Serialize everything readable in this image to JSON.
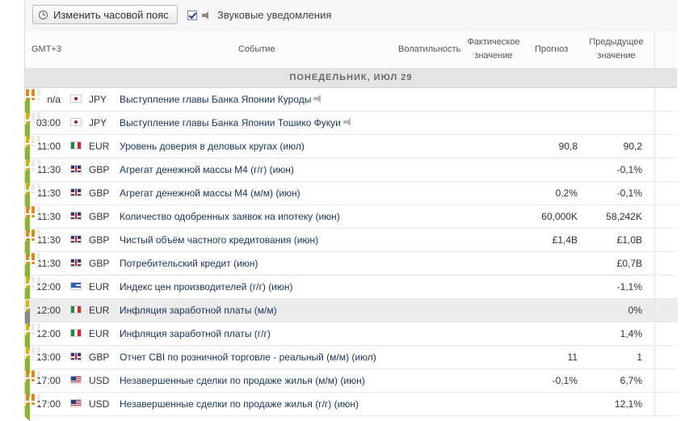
{
  "toolbar": {
    "timezone_button": "Изменить часовой пояс",
    "sound_label": "Звуковые уведомления",
    "sound_checked": true
  },
  "columns": {
    "gmt": "GMT+3",
    "event": "Событие",
    "volatility": "Волатильность",
    "actual": "Фактическое значение",
    "forecast": "Прогноз",
    "previous": "Предыдущее значение"
  },
  "day_header": "ПОНЕДЕЛЬНИК, ИЮЛ 29",
  "colors": {
    "yellow_bang": "#d8b200",
    "orange_bang": "#d98a17",
    "event_text": "#1b3760",
    "arrow": "#88b72f"
  },
  "rows": [
    {
      "time": "n/a",
      "flag": "jp",
      "currency": "JPY",
      "event": "Выступление главы Банка Японии Куроды",
      "speech": true,
      "volatility": 2,
      "actual": "",
      "forecast": "",
      "previous": "",
      "highlight": false
    },
    {
      "time": "03:00",
      "flag": "jp",
      "currency": "JPY",
      "event": "Выступление главы Банка Японии Тошико Фукуи",
      "speech": true,
      "volatility": 1,
      "actual": "",
      "forecast": "",
      "previous": "",
      "highlight": false
    },
    {
      "time": "11:00",
      "flag": "it",
      "currency": "EUR",
      "event": "Уровень доверия в деловых кругах (июл)",
      "speech": false,
      "volatility": 1,
      "actual": "",
      "forecast": "90,8",
      "previous": "90,2",
      "highlight": false
    },
    {
      "time": "11:30",
      "flag": "gb",
      "currency": "GBP",
      "event": "Агрегат денежной массы М4 (г/г) (июн)",
      "speech": false,
      "volatility": 1,
      "actual": "",
      "forecast": "",
      "previous": "-0,1%",
      "highlight": false
    },
    {
      "time": "11:30",
      "flag": "gb",
      "currency": "GBP",
      "event": "Агрегат денежной массы М4 (м/м) (июн)",
      "speech": false,
      "volatility": 1,
      "actual": "",
      "forecast": "0,2%",
      "previous": "-0,1%",
      "highlight": false
    },
    {
      "time": "11:30",
      "flag": "gb",
      "currency": "GBP",
      "event": "Количество одобренных заявок на ипотеку (июн)",
      "speech": false,
      "volatility": 2,
      "actual": "",
      "forecast": "60,000K",
      "previous": "58,242K",
      "highlight": false
    },
    {
      "time": "11:30",
      "flag": "gb",
      "currency": "GBP",
      "event": "Чистый объём частного кредитования (июн)",
      "speech": false,
      "volatility": 2,
      "actual": "",
      "forecast": "£1,4B",
      "previous": "£1,0B",
      "highlight": false
    },
    {
      "time": "11:30",
      "flag": "gb",
      "currency": "GBP",
      "event": "Потребительский кредит (июн)",
      "speech": false,
      "volatility": 2,
      "actual": "",
      "forecast": "",
      "previous": "£0,7B",
      "highlight": false
    },
    {
      "time": "12:00",
      "flag": "gr",
      "currency": "EUR",
      "event": "Индекс цен производителей (г/г) (июн)",
      "speech": false,
      "volatility": 1,
      "actual": "",
      "forecast": "",
      "previous": "-1,1%",
      "highlight": false
    },
    {
      "time": "12:00",
      "flag": "it",
      "currency": "EUR",
      "event": "Инфляция заработной платы (м/м)",
      "speech": false,
      "volatility": 1,
      "actual": "",
      "forecast": "",
      "previous": "0%",
      "highlight": true
    },
    {
      "time": "12:00",
      "flag": "it",
      "currency": "EUR",
      "event": "Инфляция заработной платы (г/г)",
      "speech": false,
      "volatility": 1,
      "actual": "",
      "forecast": "",
      "previous": "1,4%",
      "highlight": false
    },
    {
      "time": "13:00",
      "flag": "gb",
      "currency": "GBP",
      "event": "Отчет CBI по розничной торговле - реальный (м/м) (июл)",
      "speech": false,
      "volatility": 1,
      "actual": "",
      "forecast": "11",
      "previous": "1",
      "highlight": false
    },
    {
      "time": "17:00",
      "flag": "us",
      "currency": "USD",
      "event": "Незавершенные сделки по продаже жилья (м/м) (июн)",
      "speech": false,
      "volatility": 2,
      "actual": "",
      "forecast": "-0,1%",
      "previous": "6,7%",
      "highlight": false
    },
    {
      "time": "17:00",
      "flag": "us",
      "currency": "USD",
      "event": "Незавершенные сделки по продаже жилья (г/г) (июн)",
      "speech": false,
      "volatility": 2,
      "actual": "",
      "forecast": "",
      "previous": "12,1%",
      "highlight": false
    }
  ]
}
